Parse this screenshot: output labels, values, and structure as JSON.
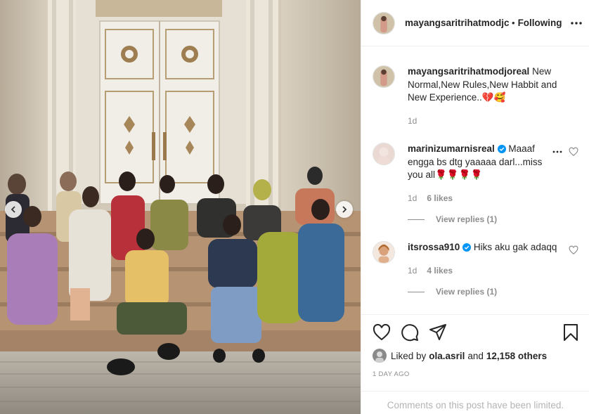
{
  "post": {
    "username": "mayangsaritrihatmodjoreal",
    "username_truncated": "mayangsaritrihatmodjc",
    "follow_separator": "•",
    "follow_label": "Following",
    "caption": {
      "username": "mayangsaritrihatmodjoreal",
      "text": "New Normal,New Rules,New Habbit and New Experience..💔🥰",
      "time": "1d"
    },
    "likes": {
      "prefix": "Liked by",
      "user": "ola.asril",
      "suffix_and": "and",
      "others": "12,158 others"
    },
    "timestamp": "1 DAY AGO",
    "comments_limited": "Comments on this post have been limited."
  },
  "comments": [
    {
      "username": "marinizumarnisreal",
      "verified": true,
      "text": "Maaaf engga bs dtg yaaaaa darl...miss you all🌹🌹🌹🌹",
      "time": "1d",
      "likes": "6 likes",
      "view_replies": "View replies (1)"
    },
    {
      "username": "itsrossa910",
      "verified": true,
      "text": "Hiks aku gak adaqq",
      "time": "1d",
      "likes": "4 likes",
      "view_replies": "View replies (1)"
    }
  ],
  "icons": {
    "like": "heart-icon",
    "comment": "comment-icon",
    "share": "share-icon",
    "save": "bookmark-icon",
    "more": "more-horizontal-icon",
    "verified": "verified-badge-icon",
    "prev": "chevron-left-icon",
    "next": "chevron-right-icon"
  },
  "colors": {
    "text": "#262626",
    "secondary": "#8e8e8e",
    "verified": "#0095f6",
    "border": "#efefef"
  }
}
